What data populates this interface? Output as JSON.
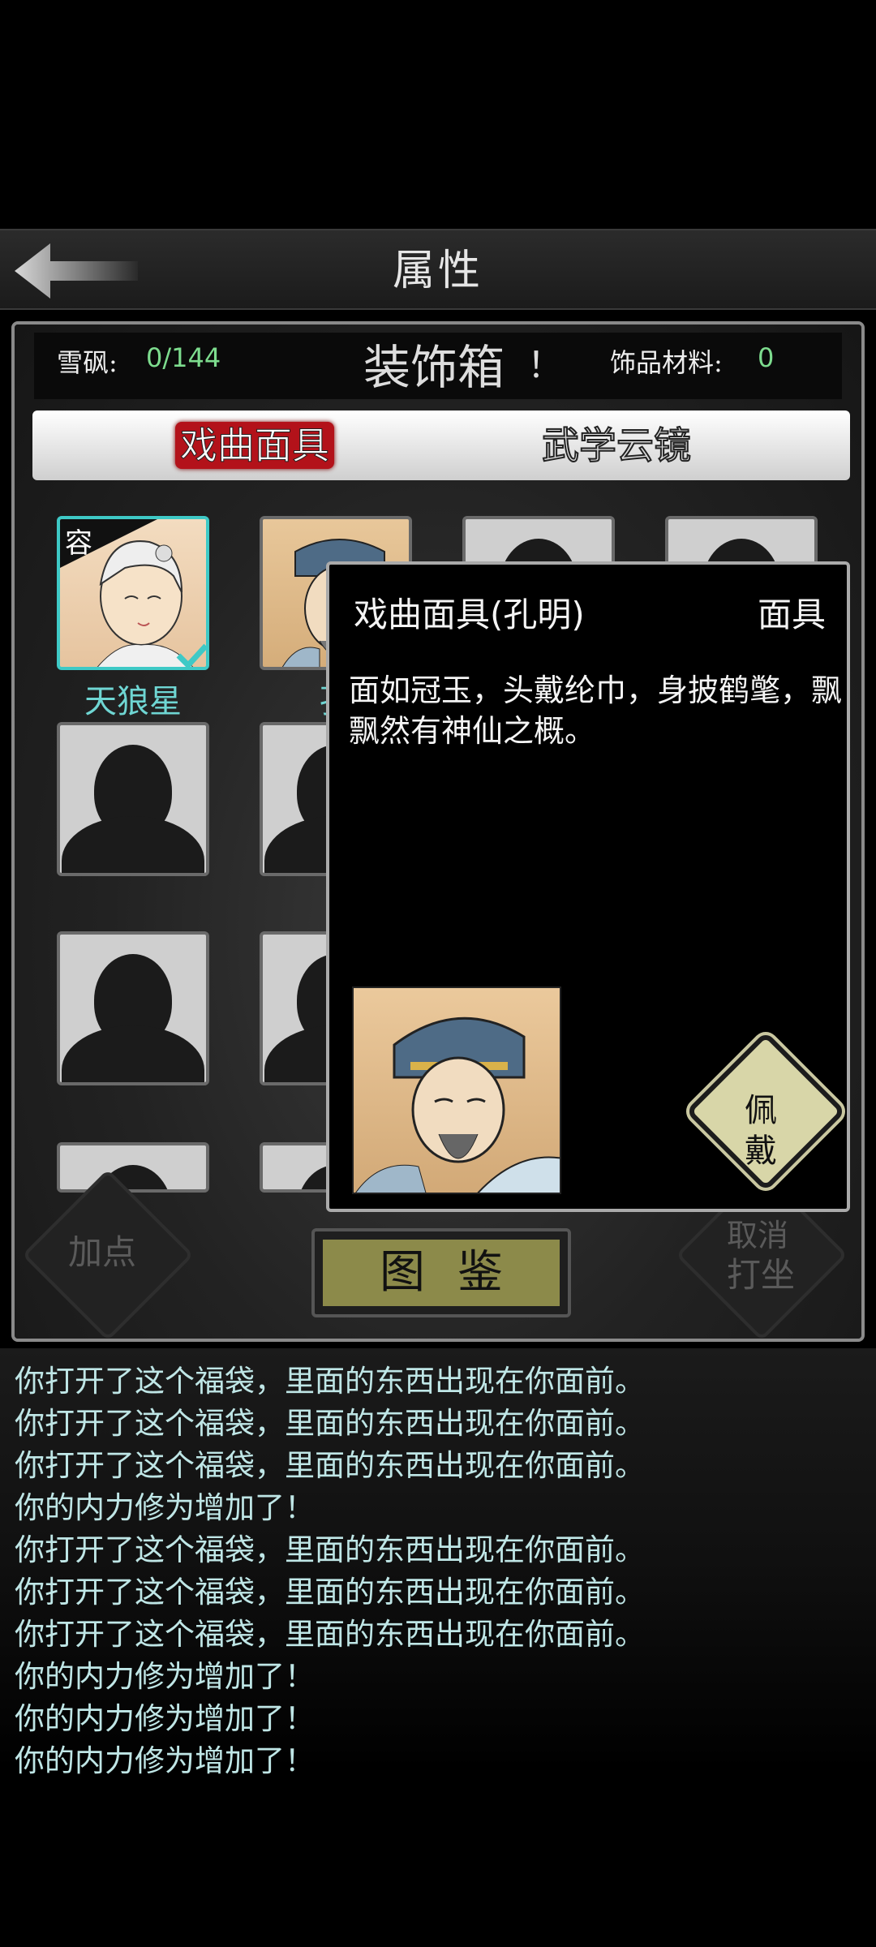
{
  "header": {
    "title": "属性"
  },
  "status": {
    "snow_label": "雪砜:",
    "snow_value": "0/144",
    "box_title": "装饰箱",
    "box_mark": "！",
    "material_label": "饰品材料:",
    "material_value": "0"
  },
  "tabs": [
    {
      "label": "戏曲面具",
      "active": true
    },
    {
      "label": "武学云镜",
      "active": false
    }
  ],
  "grid": {
    "first_slot_badge": "容",
    "labels": [
      "天狼星",
      "孔"
    ]
  },
  "buttons": {
    "add_point": "加点",
    "meditate_top": "取消",
    "meditate_bottom": "打坐",
    "atlas": "图鉴"
  },
  "popup": {
    "name": "戏曲面具(孔明)",
    "type": "面具",
    "description": "面如冠玉，头戴纶巾，身披鹤氅，飘飘然有神仙之概。",
    "wear_1": "佩",
    "wear_2": "戴"
  },
  "log": [
    "你打开了这个福袋，里面的东西出现在你面前。",
    "你打开了这个福袋，里面的东西出现在你面前。",
    "你打开了这个福袋，里面的东西出现在你面前。",
    "你的内力修为增加了！",
    "你打开了这个福袋，里面的东西出现在你面前。",
    "你打开了这个福袋，里面的东西出现在你面前。",
    "你打开了这个福袋，里面的东西出现在你面前。",
    "你的内力修为增加了！",
    "你的内力修为增加了！",
    "你的内力修为增加了！"
  ],
  "colors": {
    "accent_teal": "#3ec9c6",
    "value_green": "#7ddc8e",
    "tab_red": "#b3121a",
    "atlas_olive": "#8c8a4a"
  }
}
